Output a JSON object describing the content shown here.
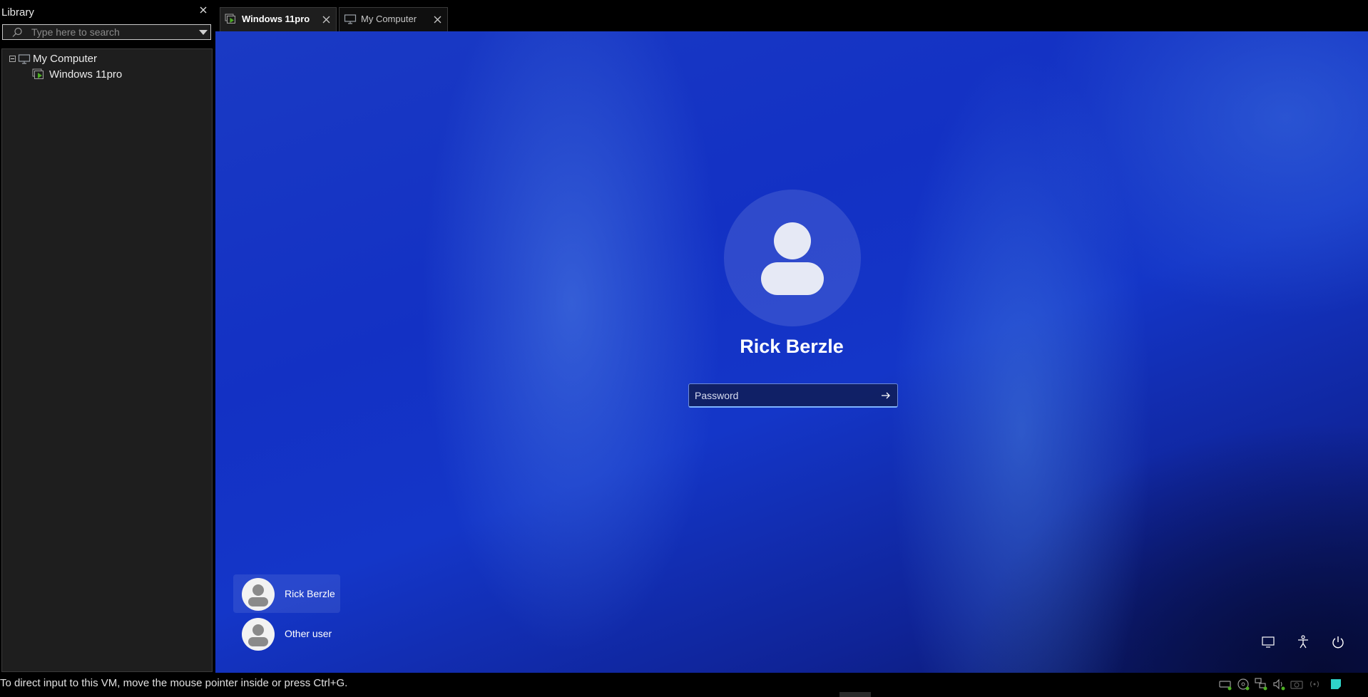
{
  "library": {
    "title": "Library",
    "search_placeholder": "Type here to search",
    "tree": [
      {
        "label": "My Computer",
        "icon": "monitor-icon"
      },
      {
        "label": "Windows 11pro",
        "icon": "vm-running-icon"
      }
    ]
  },
  "tabs": [
    {
      "label": "Windows 11pro",
      "icon": "vm-running-icon",
      "active": true
    },
    {
      "label": "My Computer",
      "icon": "monitor-icon",
      "active": false
    }
  ],
  "vm": {
    "username": "Rick Berzle",
    "password_placeholder": "Password",
    "users": [
      {
        "name": "Rick Berzle",
        "selected": true
      },
      {
        "name": "Other user",
        "selected": false
      }
    ],
    "corner_icons": [
      "display-icon",
      "accessibility-icon",
      "power-icon"
    ]
  },
  "statusbar": {
    "message": "To direct input to this VM, move the mouse pointer inside or press Ctrl+G.",
    "icons": [
      "hard-disk-icon",
      "cd-icon",
      "network-icon",
      "sound-icon",
      "camera-icon",
      "wireless-icon",
      "message-icon"
    ]
  },
  "colors": {
    "accent_green": "#4caf22",
    "accent_teal": "#2fd3c8"
  }
}
